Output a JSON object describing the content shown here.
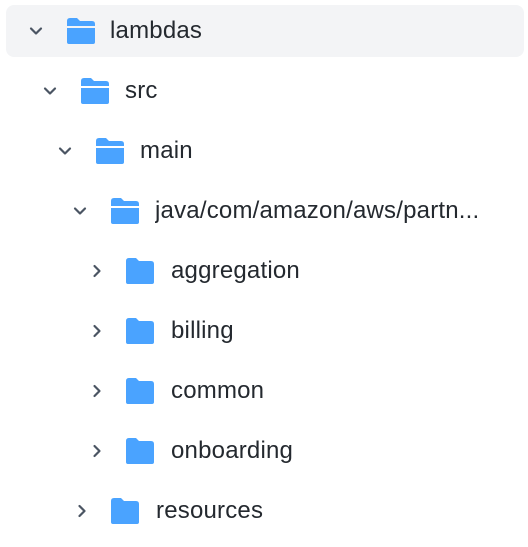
{
  "tree": {
    "items": [
      {
        "label": "lambdas",
        "expanded": true,
        "selected": true,
        "icon": "folder-open-icon"
      },
      {
        "label": "src",
        "expanded": true,
        "selected": false,
        "icon": "folder-open-icon"
      },
      {
        "label": "main",
        "expanded": true,
        "selected": false,
        "icon": "folder-open-icon"
      },
      {
        "label": "java/com/amazon/aws/partn...",
        "expanded": true,
        "selected": false,
        "icon": "folder-open-icon"
      },
      {
        "label": "aggregation",
        "expanded": false,
        "selected": false,
        "icon": "folder-icon"
      },
      {
        "label": "billing",
        "expanded": false,
        "selected": false,
        "icon": "folder-icon"
      },
      {
        "label": "common",
        "expanded": false,
        "selected": false,
        "icon": "folder-icon"
      },
      {
        "label": "onboarding",
        "expanded": false,
        "selected": false,
        "icon": "folder-icon"
      },
      {
        "label": "resources",
        "expanded": false,
        "selected": false,
        "icon": "folder-icon"
      }
    ]
  },
  "colors": {
    "folder": "#4aa3ff",
    "chevron": "#4b5563",
    "selected_bg": "#f3f4f6",
    "text": "#24292f"
  }
}
